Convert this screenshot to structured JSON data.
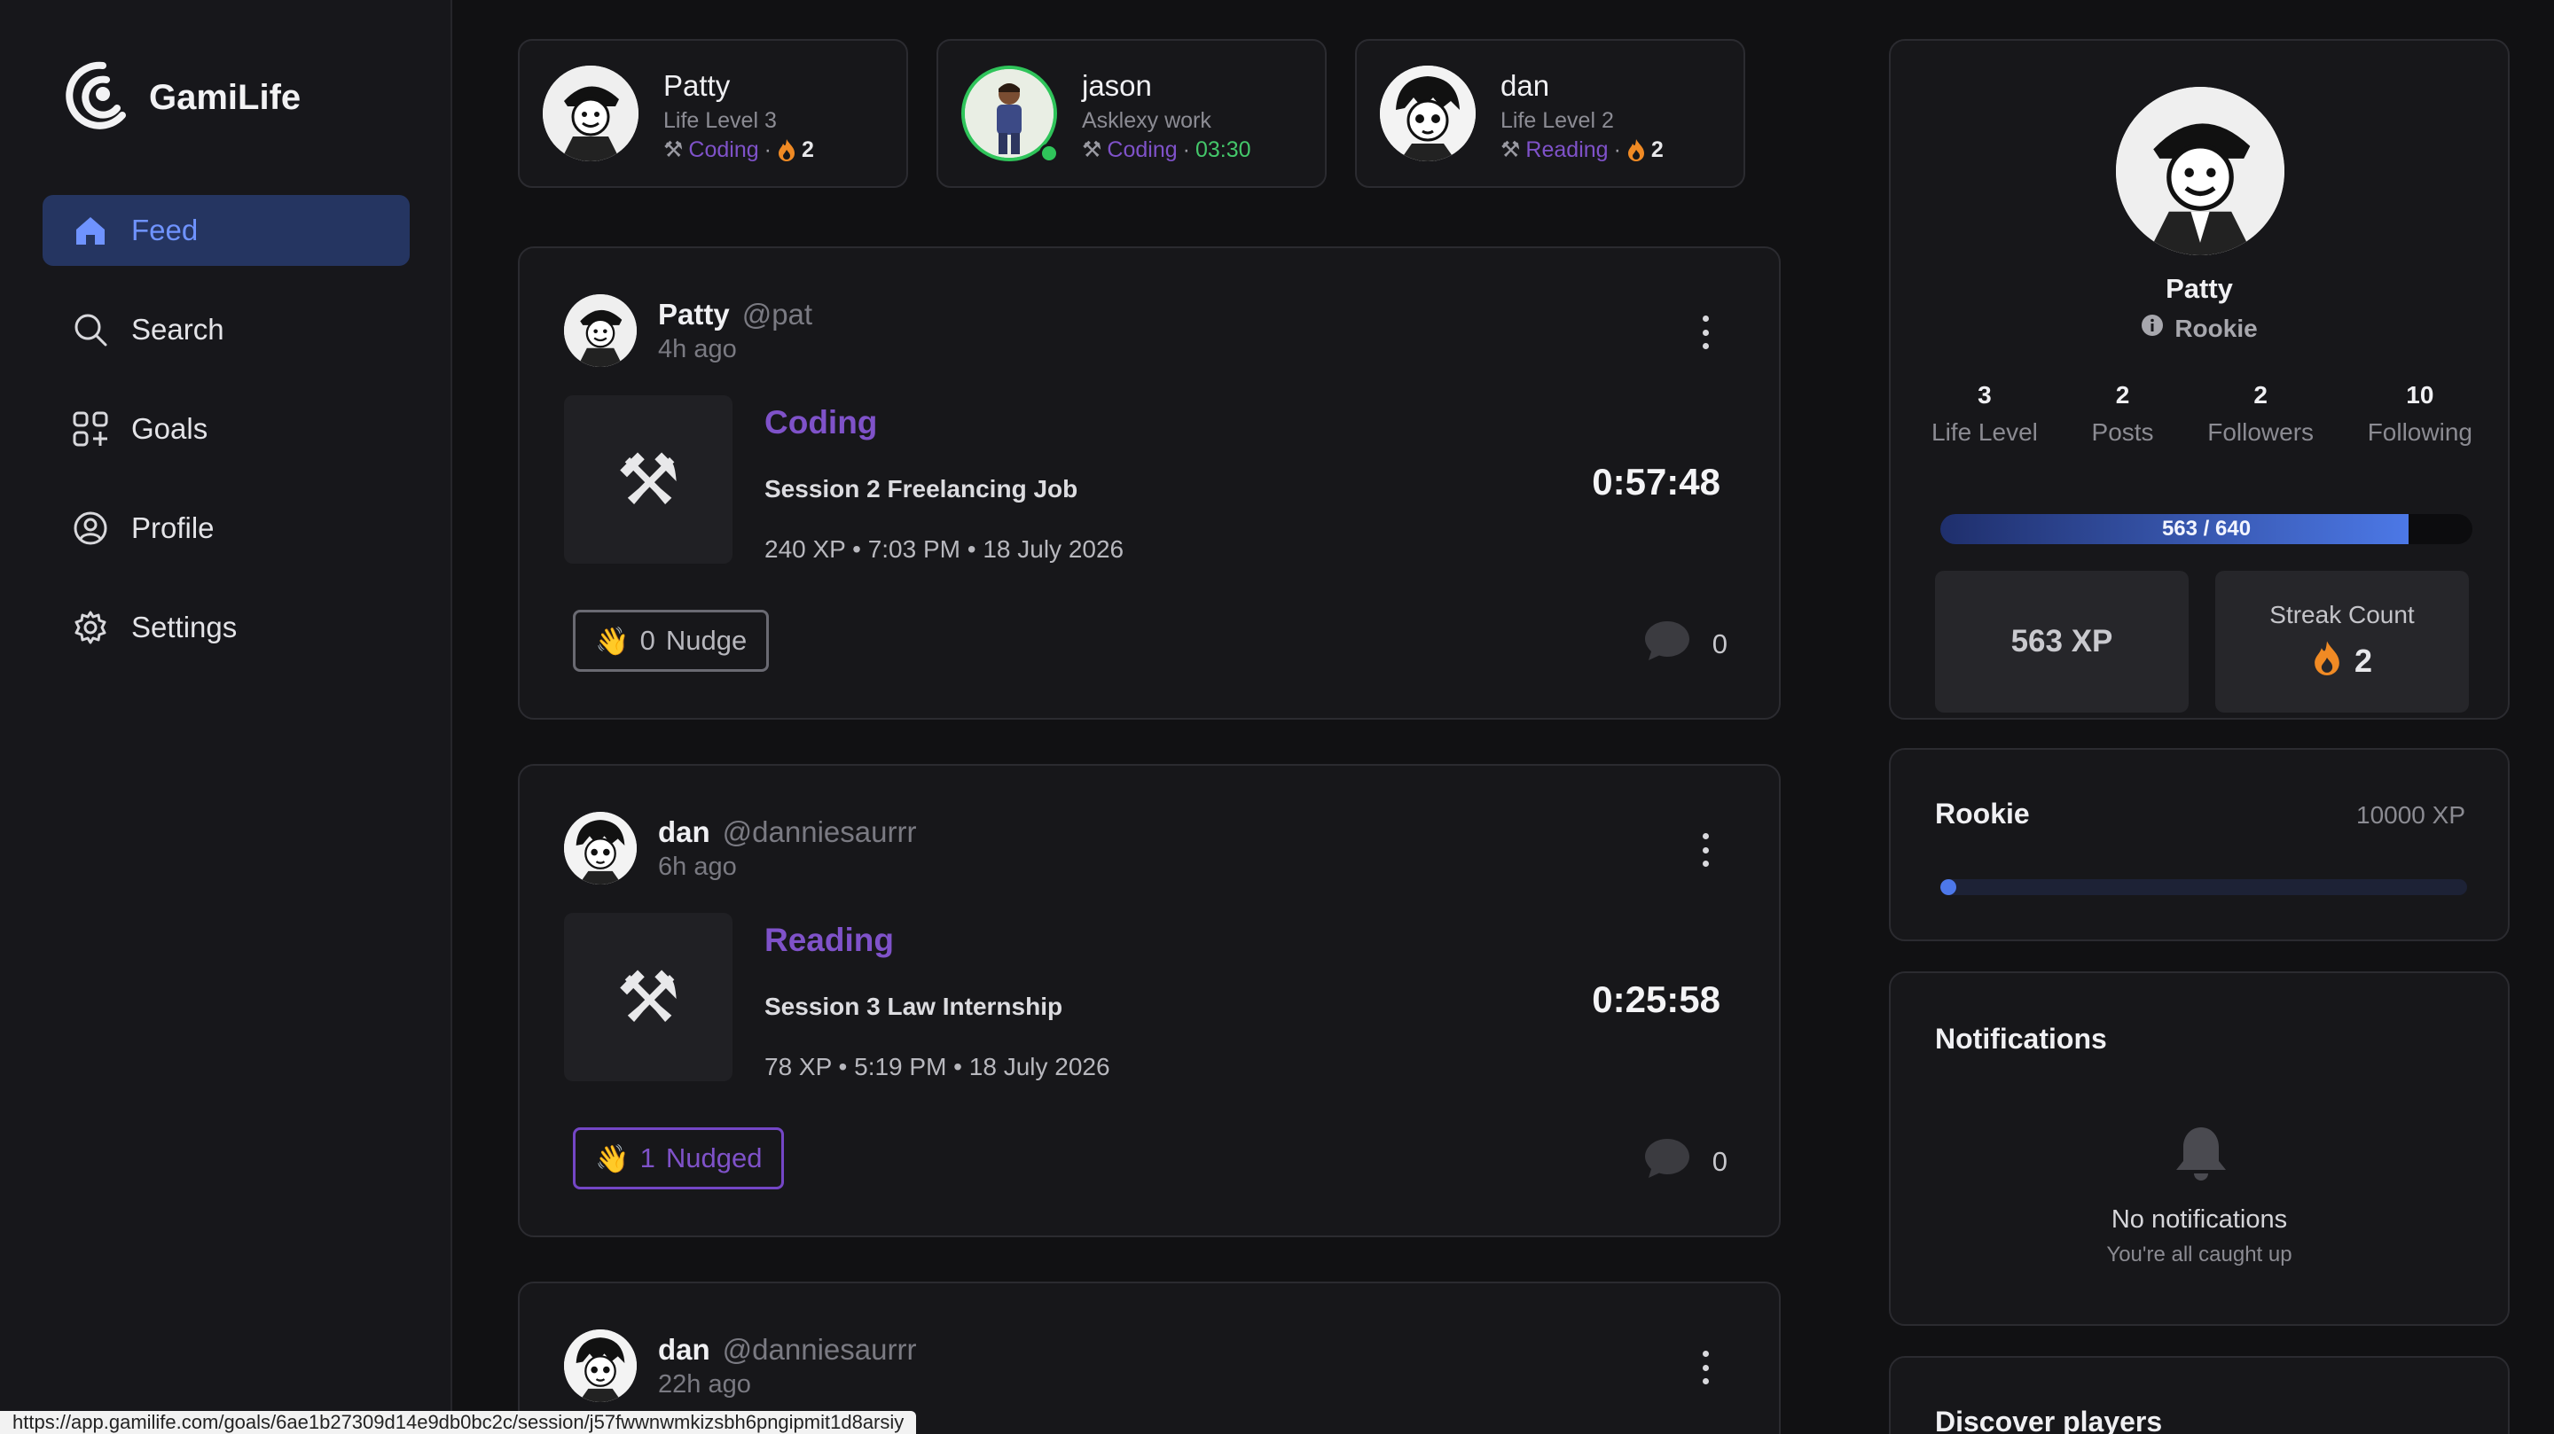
{
  "app": {
    "name": "GamiLife"
  },
  "nav": [
    {
      "label": "Feed",
      "icon": "home-icon",
      "active": true
    },
    {
      "label": "Search",
      "icon": "search-icon"
    },
    {
      "label": "Goals",
      "icon": "goals-icon"
    },
    {
      "label": "Profile",
      "icon": "profile-icon"
    },
    {
      "label": "Settings",
      "icon": "gear-icon"
    }
  ],
  "active_users": [
    {
      "name": "Patty",
      "sub": "Life Level 3",
      "activity": "Coding",
      "extra": "2",
      "extra_type": "streak"
    },
    {
      "name": "jason",
      "sub": "Asklexy work",
      "activity": "Coding",
      "extra": "03:30",
      "extra_type": "timer",
      "online": true
    },
    {
      "name": "dan",
      "sub": "Life Level 2",
      "activity": "Reading",
      "extra": "2",
      "extra_type": "streak"
    }
  ],
  "posts": [
    {
      "name": "Patty",
      "handle": "@pat",
      "time": "4h ago",
      "activity": "Coding",
      "session": "Session 2 Freelancing Job",
      "details": "240 XP • 7:03 PM • 18 July 2026",
      "duration": "0:57:48",
      "nudge_count": "0",
      "nudge_label": "Nudge",
      "nudged": false,
      "comments": "0"
    },
    {
      "name": "dan",
      "handle": "@danniesaurrr",
      "time": "6h ago",
      "activity": "Reading",
      "session": "Session 3 Law Internship",
      "details": "78 XP • 5:19 PM • 18 July 2026",
      "duration": "0:25:58",
      "nudge_count": "1",
      "nudge_label": "Nudged",
      "nudged": true,
      "comments": "0"
    },
    {
      "name": "dan",
      "handle": "@danniesaurrr",
      "time": "22h ago"
    }
  ],
  "profile": {
    "name": "Patty",
    "rank": "Rookie",
    "stats": [
      {
        "value": "3",
        "label": "Life Level"
      },
      {
        "value": "2",
        "label": "Posts"
      },
      {
        "value": "2",
        "label": "Followers"
      },
      {
        "value": "10",
        "label": "Following"
      }
    ],
    "xp_bar_text": "563 / 640",
    "xp_progress": 0.88,
    "xp_box": "563 XP",
    "streak_label": "Streak Count",
    "streak_value": "2"
  },
  "rank_panel": {
    "title": "Rookie",
    "xp_goal": "10000 XP",
    "progress": 0.03
  },
  "notifications": {
    "title": "Notifications",
    "empty": "No notifications",
    "sub": "You're all caught up"
  },
  "discover": {
    "title": "Discover players"
  },
  "statusbar": {
    "url": "https://app.gamilife.com/goals/6ae1b27309d14e9db0bc2c/session/j57fwwnwmkizsbh6pngipmit1d8arsiy"
  },
  "colors": {
    "accent_blue": "#4c78e6",
    "activity_purple": "#7f52c9",
    "online_green": "#2fc45a",
    "streak_orange": "#f08a24"
  }
}
